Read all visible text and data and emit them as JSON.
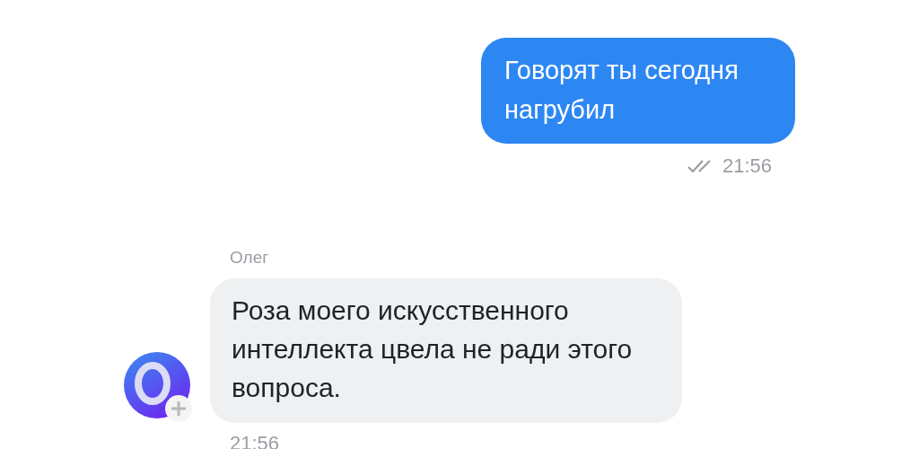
{
  "messages": [
    {
      "kind": "outgoing",
      "text": "Говорят ты сегодня нагрубил",
      "time": "21:56",
      "read": true
    },
    {
      "kind": "incoming",
      "sender": "Олег",
      "text": "Роза моего искусственного интеллекта цвела не ради этого вопроса.",
      "time": "21:56"
    }
  ]
}
